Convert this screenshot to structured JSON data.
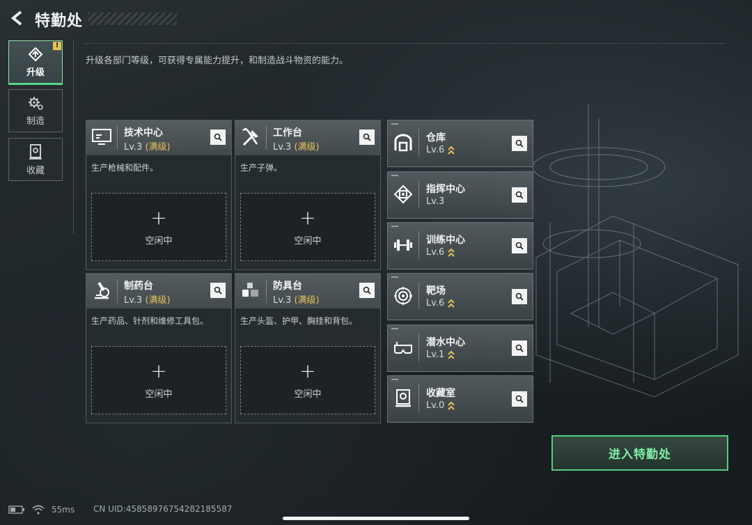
{
  "header": {
    "title": "特勤处"
  },
  "nav": [
    {
      "label": "升级",
      "icon": "upgrade-icon",
      "active": true,
      "badge": "!"
    },
    {
      "label": "制造",
      "icon": "gear-icon",
      "active": false
    },
    {
      "label": "收藏",
      "icon": "collection-icon",
      "active": false
    }
  ],
  "description": "升级各部门等级，可获得专属能力提升，和制造战斗物资的能力。",
  "departments": [
    {
      "name": "技术中心",
      "level": "Lv.3",
      "max": "(满级)",
      "desc": "生产枪械和配件。",
      "slot_label": "空闲中",
      "icon": "monitor-icon"
    },
    {
      "name": "工作台",
      "level": "Lv.3",
      "max": "(满级)",
      "desc": "生产子弹。",
      "slot_label": "空闲中",
      "icon": "tools-icon"
    },
    {
      "name": "制药台",
      "level": "Lv.3",
      "max": "(满级)",
      "desc": "生产药品、针剂和维修工具包。",
      "slot_label": "空闲中",
      "icon": "microscope-icon"
    },
    {
      "name": "防具台",
      "level": "Lv.3",
      "max": "(满级)",
      "desc": "生产头盔、护甲、胸挂和背包。",
      "slot_label": "空闲中",
      "icon": "armor-icon"
    }
  ],
  "facilities": [
    {
      "name": "仓库",
      "level": "Lv.6",
      "upgradable": true,
      "icon": "warehouse-icon"
    },
    {
      "name": "指挥中心",
      "level": "Lv.3",
      "upgradable": false,
      "icon": "command-icon"
    },
    {
      "name": "训练中心",
      "level": "Lv.6",
      "upgradable": true,
      "icon": "dumbbell-icon"
    },
    {
      "name": "靶场",
      "level": "Lv.6",
      "upgradable": true,
      "icon": "target-icon"
    },
    {
      "name": "潜水中心",
      "level": "Lv.1",
      "upgradable": true,
      "icon": "diving-mask-icon"
    },
    {
      "name": "收藏室",
      "level": "Lv.0",
      "upgradable": true,
      "icon": "collection-room-icon"
    }
  ],
  "enter_button": "进入特勤处",
  "status": {
    "ping": "55ms",
    "uid": "CN UID:4585897675428218558​7"
  },
  "colors": {
    "accent_green": "#4fcf82",
    "max_gold": "#e5c35a"
  }
}
